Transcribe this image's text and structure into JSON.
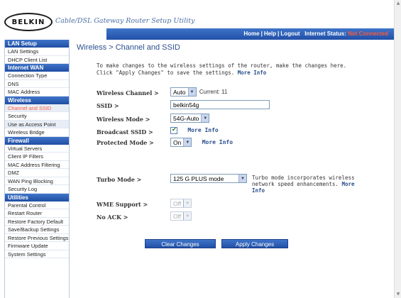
{
  "header": {
    "logo_text": "BELKIN",
    "app_title": "Cable/DSL Gateway Router Setup Utility",
    "links": [
      "Home",
      "Help",
      "Logout"
    ],
    "status_label": "Internet Status:",
    "status_value": "Not Connected"
  },
  "sidebar": {
    "sections": [
      {
        "title": "LAN Setup",
        "items": [
          "LAN Settings",
          "DHCP Client List"
        ]
      },
      {
        "title": "Internet WAN",
        "items": [
          "Connection Type",
          "DNS",
          "MAC Address"
        ]
      },
      {
        "title": "Wireless",
        "items": [
          "Channel and SSID",
          "Security",
          "Use as Access Point",
          "Wireless Bridge"
        ]
      },
      {
        "title": "Firewall",
        "items": [
          "Virtual Servers",
          "Client IP Filters",
          "MAC Address Filtering",
          "DMZ",
          "WAN Ping Blocking",
          "Security Log"
        ]
      },
      {
        "title": "Utilities",
        "items": [
          "Parental Control",
          "Restart Router",
          "Restore Factory Default",
          "Save/Backup Settings",
          "Restore Previous Settings",
          "Firmware Update",
          "System Settings"
        ]
      }
    ]
  },
  "main": {
    "title": "Wireless > Channel and SSID",
    "intro": "To make changes to the wireless settings of the router, make the changes here. Click \"Apply Changes\" to save the settings.",
    "more_info": "More Info",
    "channel": {
      "label": "Wireless Channel >",
      "value": "Auto",
      "current": "Current: 11"
    },
    "ssid": {
      "label": "SSID >",
      "value": "belkin54g"
    },
    "mode": {
      "label": "Wireless Mode >",
      "value": "54G-Auto"
    },
    "broadcast": {
      "label": "Broadcast SSID >",
      "more": "More Info"
    },
    "protected": {
      "label": "Protected Mode >",
      "value": "On",
      "more": "More Info"
    },
    "turbo": {
      "label": "Turbo Mode >",
      "value": "125 G PLUS mode",
      "note": "Turbo mode incorporates wireless network speed enhancements.",
      "more": "More Info"
    },
    "wme": {
      "label": "WME Support >",
      "value": "Off"
    },
    "noack": {
      "label": "No ACK >",
      "value": "Off"
    },
    "buttons": {
      "clear": "Clear Changes",
      "apply": "Apply Changes"
    }
  },
  "colors": {
    "accent": "#2150a8",
    "status": "#ff5a3c"
  }
}
